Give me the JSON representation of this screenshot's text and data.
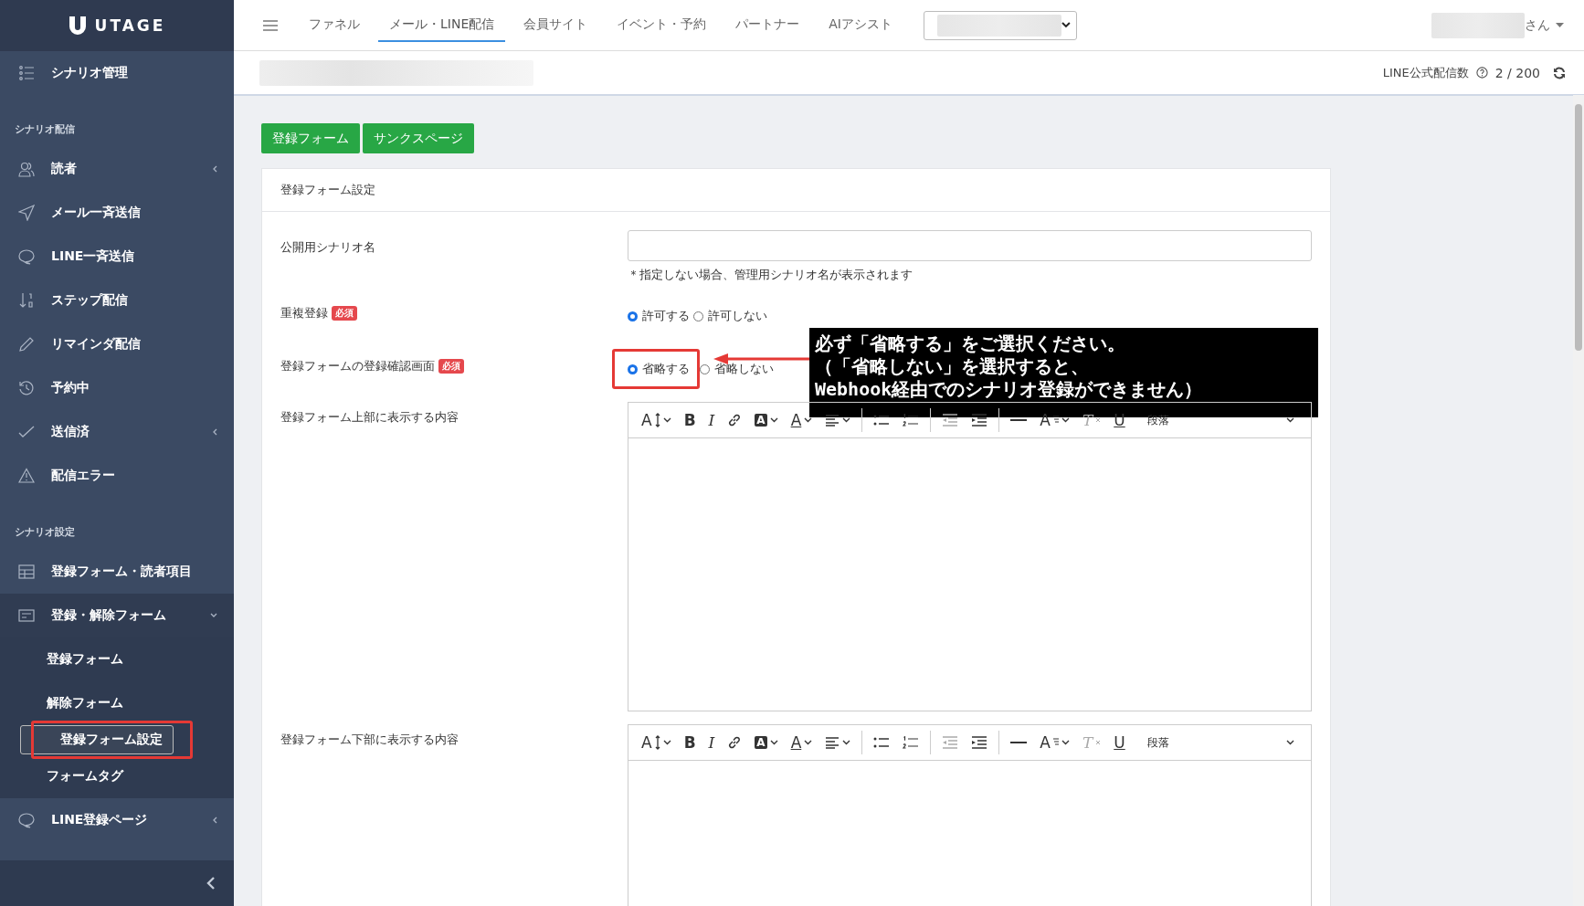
{
  "logo": {
    "text": "UTAGE"
  },
  "sidebar": {
    "items": [
      {
        "kind": "link",
        "label": "シナリオ管理"
      },
      {
        "kind": "heading",
        "label": "シナリオ配信"
      },
      {
        "kind": "link",
        "label": "読者",
        "expanded": false
      },
      {
        "kind": "link",
        "label": "メール一斉送信"
      },
      {
        "kind": "link",
        "label": "LINE一斉送信"
      },
      {
        "kind": "link",
        "label": "ステップ配信"
      },
      {
        "kind": "link",
        "label": "リマインダ配信"
      },
      {
        "kind": "link",
        "label": "予約中"
      },
      {
        "kind": "link",
        "label": "送信済",
        "expanded": false
      },
      {
        "kind": "link",
        "label": "配信エラー"
      },
      {
        "kind": "heading",
        "label": "シナリオ設定"
      },
      {
        "kind": "link",
        "label": "登録フォーム・読者項目"
      },
      {
        "kind": "link",
        "label": "登録・解除フォーム",
        "expanded": true,
        "children": [
          {
            "label": "登録フォーム",
            "selected": false,
            "highlighted": false
          },
          {
            "label": "解除フォーム",
            "selected": false,
            "highlighted": false
          },
          {
            "label": "登録フォーム設定",
            "selected": true,
            "highlighted": true
          },
          {
            "label": "フォームタグ",
            "selected": false,
            "highlighted": false
          }
        ]
      },
      {
        "kind": "link",
        "label": "LINE登録ページ",
        "expanded": false
      }
    ]
  },
  "topbar": {
    "tabs": [
      {
        "label": "ファネル",
        "selected": false
      },
      {
        "label": "メール・LINE配信",
        "selected": true
      },
      {
        "label": "会員サイト",
        "selected": false
      },
      {
        "label": "イベント・予約",
        "selected": false
      },
      {
        "label": "パートナー",
        "selected": false
      },
      {
        "label": "AIアシスト",
        "selected": false
      }
    ],
    "user_suffix": "さん"
  },
  "subbar": {
    "quota_label": "LINE公式配信数",
    "quota_value": "2 / 200"
  },
  "page_buttons": [
    "登録フォーム",
    "サンクスページ"
  ],
  "card": {
    "title": "登録フォーム設定",
    "fields": [
      {
        "kind": "text",
        "label": "公開用シナリオ名",
        "help": "＊指定しない場合、管理用シナリオ名が表示されます"
      },
      {
        "kind": "radio",
        "label": "重複登録",
        "badge": "必須",
        "options": [
          {
            "label": "許可する",
            "selected": true,
            "highlighted": false
          },
          {
            "label": "許可しない",
            "selected": false,
            "highlighted": false
          }
        ]
      },
      {
        "kind": "radio",
        "label": "登録フォームの登録確認画面",
        "badge": "必須",
        "options": [
          {
            "label": "省略する",
            "selected": true,
            "highlighted": true
          },
          {
            "label": "省略しない",
            "selected": false,
            "highlighted": false
          }
        ],
        "callout": {
          "lines": [
            "必ず「省略する」をご選択ください。",
            "（「省略しない」を選択すると、",
            "Webhook経由でのシナリオ登録ができません）"
          ]
        }
      },
      {
        "kind": "editor",
        "label": "登録フォーム上部に表示する内容",
        "toolbar": [
          {
            "kind": "size",
            "text": "A"
          },
          {
            "kind": "bold",
            "text": "B"
          },
          {
            "kind": "italic",
            "text": "I"
          },
          {
            "kind": "link"
          },
          {
            "kind": "highlight",
            "text": "A"
          },
          {
            "kind": "color",
            "text": "A"
          },
          {
            "kind": "align"
          },
          {
            "kind": "sep"
          },
          {
            "kind": "bullets"
          },
          {
            "kind": "numbers"
          },
          {
            "kind": "sep"
          },
          {
            "kind": "outdent",
            "disabled": true
          },
          {
            "kind": "indent",
            "disabled": false
          },
          {
            "kind": "sep"
          },
          {
            "kind": "hr"
          },
          {
            "kind": "style",
            "text": "A"
          },
          {
            "kind": "clear",
            "text": "T",
            "disabled": true
          },
          {
            "kind": "underline",
            "text": "U"
          },
          {
            "kind": "format",
            "text": "段落"
          }
        ]
      },
      {
        "kind": "editor",
        "label": "登録フォーム下部に表示する内容",
        "toolbar": [
          {
            "kind": "size",
            "text": "A"
          },
          {
            "kind": "bold",
            "text": "B"
          },
          {
            "kind": "italic",
            "text": "I"
          },
          {
            "kind": "link"
          },
          {
            "kind": "highlight",
            "text": "A"
          },
          {
            "kind": "color",
            "text": "A"
          },
          {
            "kind": "align"
          },
          {
            "kind": "sep"
          },
          {
            "kind": "bullets"
          },
          {
            "kind": "numbers"
          },
          {
            "kind": "sep"
          },
          {
            "kind": "outdent",
            "disabled": true
          },
          {
            "kind": "indent",
            "disabled": false
          },
          {
            "kind": "sep"
          },
          {
            "kind": "hr"
          },
          {
            "kind": "style",
            "text": "A"
          },
          {
            "kind": "clear",
            "text": "T",
            "disabled": true
          },
          {
            "kind": "underline",
            "text": "U"
          },
          {
            "kind": "format",
            "text": "段落"
          }
        ]
      }
    ]
  }
}
